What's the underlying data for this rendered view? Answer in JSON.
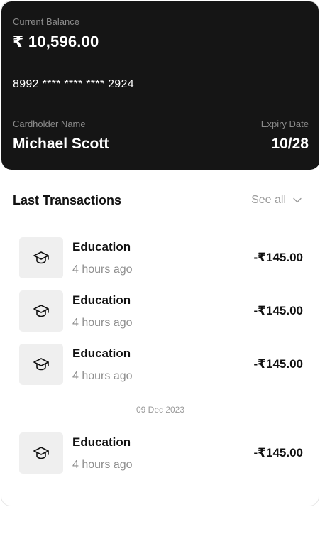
{
  "card": {
    "balance_label": "Current Balance",
    "balance": "₹ 10,596.00",
    "number": "8992 **** **** **** 2924",
    "holder_label": "Cardholder Name",
    "holder": "Michael Scott",
    "expiry_label": "Expiry Date",
    "expiry": "10/28"
  },
  "transactions": {
    "title": "Last Transactions",
    "see_all": "See all",
    "date_separator": "09 Dec 2023",
    "items": [
      {
        "category": "Education",
        "time": "4 hours ago",
        "amount": "-₹145.00",
        "icon": "graduation-cap-icon"
      },
      {
        "category": "Education",
        "time": "4 hours ago",
        "amount": "-₹145.00",
        "icon": "graduation-cap-icon"
      },
      {
        "category": "Education",
        "time": "4 hours ago",
        "amount": "-₹145.00",
        "icon": "graduation-cap-icon"
      },
      {
        "category": "Education",
        "time": "4 hours ago",
        "amount": "-₹145.00",
        "icon": "graduation-cap-icon"
      }
    ]
  },
  "colors": {
    "card_background": "#151515",
    "icon_tile": "#efefef",
    "muted_text": "#8e8e8e"
  }
}
